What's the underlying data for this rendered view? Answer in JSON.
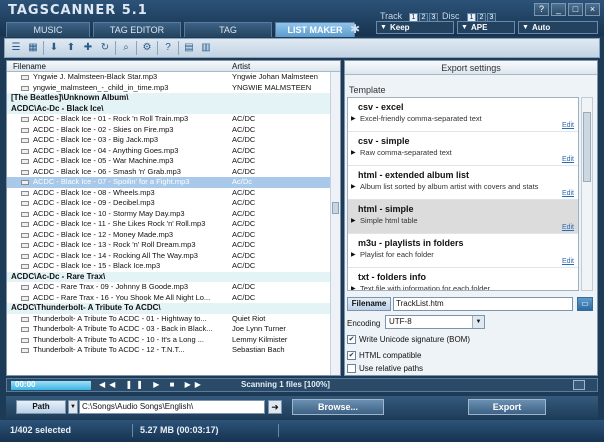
{
  "app": {
    "title": "TAGSCANNER 5.1",
    "window_buttons": [
      "?",
      "_",
      "□",
      "×"
    ]
  },
  "options": {
    "track_label": "Track",
    "track_values": [
      "1",
      "2",
      "3"
    ],
    "disc_label": "Disc",
    "disc_values": [
      "1",
      "2",
      "3"
    ],
    "keep": "Keep",
    "ape": "APE",
    "auto": "Auto"
  },
  "tabs": [
    "MUSIC RENAMER",
    "TAG EDITOR",
    "TAG PROCESSOR",
    "LIST MAKER"
  ],
  "filelist": {
    "col_filename": "Filename",
    "col_artist": "Artist",
    "rows": [
      {
        "type": "file",
        "fn": "Yngwie J. Malmsteen-Black Star.mp3",
        "ar": "Yngwie Johan Malmsteen"
      },
      {
        "type": "file",
        "fn": "yngwie_malmsteen_-_child_in_time.mp3",
        "ar": "YNGWIE MALMSTEEN"
      },
      {
        "type": "group",
        "fn": "[The Beatles]\\Unknown Album\\"
      },
      {
        "type": "group",
        "fn": "ACDC\\Ac-Dc - Black Ice\\"
      },
      {
        "type": "file",
        "fn": "ACDC - Black Ice - 01 - Rock 'n Roll Train.mp3",
        "ar": "AC/DC"
      },
      {
        "type": "file",
        "fn": "ACDC - Black Ice - 02 - Skies on Fire.mp3",
        "ar": "AC/DC"
      },
      {
        "type": "file",
        "fn": "ACDC - Black Ice - 03 - Big Jack.mp3",
        "ar": "AC/DC"
      },
      {
        "type": "file",
        "fn": "ACDC - Black Ice - 04 - Anything Goes.mp3",
        "ar": "AC/DC"
      },
      {
        "type": "file",
        "fn": "ACDC - Black Ice - 05 - War Machine.mp3",
        "ar": "AC/DC"
      },
      {
        "type": "file",
        "fn": "ACDC - Black Ice - 06 - Smash 'n' Grab.mp3",
        "ar": "AC/DC"
      },
      {
        "type": "selected",
        "fn": "ACDC - Black Ice - 07 - Spoilin' for a Fight.mp3",
        "ar": "Ac/Dc"
      },
      {
        "type": "file",
        "fn": "ACDC - Black Ice - 08 - Wheels.mp3",
        "ar": "AC/DC"
      },
      {
        "type": "file",
        "fn": "ACDC - Black Ice - 09 - Decibel.mp3",
        "ar": "AC/DC"
      },
      {
        "type": "file",
        "fn": "ACDC - Black Ice - 10 - Stormy May Day.mp3",
        "ar": "AC/DC"
      },
      {
        "type": "file",
        "fn": "ACDC - Black Ice - 11 - She Likes Rock 'n' Roll.mp3",
        "ar": "AC/DC"
      },
      {
        "type": "file",
        "fn": "ACDC - Black Ice - 12 - Money Made.mp3",
        "ar": "AC/DC"
      },
      {
        "type": "file",
        "fn": "ACDC - Black Ice - 13 - Rock 'n' Roll Dream.mp3",
        "ar": "AC/DC"
      },
      {
        "type": "file",
        "fn": "ACDC - Black Ice - 14 - Rocking All The Way.mp3",
        "ar": "AC/DC"
      },
      {
        "type": "file",
        "fn": "ACDC - Black Ice - 15 - Black Ice.mp3",
        "ar": "AC/DC"
      },
      {
        "type": "group",
        "fn": "ACDC\\Ac-Dc - Rare Trax\\"
      },
      {
        "type": "file",
        "fn": "ACDC - Rare Trax - 09 - Johnny B Goode.mp3",
        "ar": "AC/DC"
      },
      {
        "type": "file",
        "fn": "ACDC - Rare Trax - 16 - You Shook Me All Night Lo...",
        "ar": "AC/DC"
      },
      {
        "type": "group",
        "fn": "ACDC\\Thunderbolt- A Tribute To ACDC\\"
      },
      {
        "type": "file",
        "fn": "Thunderbolt- A Tribute To ACDC - 01 - Hightway to...",
        "ar": "Quiet Riot"
      },
      {
        "type": "file",
        "fn": "Thunderbolt- A Tribute To ACDC - 03 - Back in Black...",
        "ar": "Joe Lynn Turner"
      },
      {
        "type": "file",
        "fn": "Thunderbolt- A Tribute To ACDC - 10 - It's a Long ...",
        "ar": "Lemmy Kilmister"
      },
      {
        "type": "file",
        "fn": "Thunderbolt- A Tribute To ACDC - 12 - T.N.T...",
        "ar": "Sebastian Bach"
      }
    ]
  },
  "export": {
    "header": "Export settings",
    "template_label": "Template",
    "templates": [
      {
        "name": "csv - excel",
        "desc": "Excel-friendly comma-separated text",
        "edit": "Edit"
      },
      {
        "name": "csv - simple",
        "desc": "Raw comma-separated text",
        "edit": "Edit"
      },
      {
        "name": "html - extended album list",
        "desc": "Album list sorted by album artist with covers and stats",
        "edit": "Edit"
      },
      {
        "name": "html - simple",
        "desc": "Simple html table",
        "edit": "Edit"
      },
      {
        "name": "m3u - playlists in folders",
        "desc": "Playlist for each folder",
        "edit": "Edit"
      },
      {
        "name": "txt - folders info",
        "desc": "Text file with information for each folder",
        "edit": "Edit"
      }
    ],
    "filename_label": "Filename",
    "filename_value": "TrackList.htm",
    "encoding_label": "Encoding",
    "encoding_value": "UTF-8",
    "chk_bom": "Write Unicode signature (BOM)",
    "chk_html": "HTML compatible",
    "chk_relative": "Use relative paths"
  },
  "progress": {
    "time": "00:00",
    "status": "Scanning 1 files [100%]"
  },
  "pathbar": {
    "path_label": "Path",
    "path_value": "C:\\Songs\\Audio Songs\\English\\",
    "browse": "Browse...",
    "export": "Export"
  },
  "statusbar": {
    "selected": "1/402 selected",
    "size": "5.27 MB (00:03:17)"
  }
}
